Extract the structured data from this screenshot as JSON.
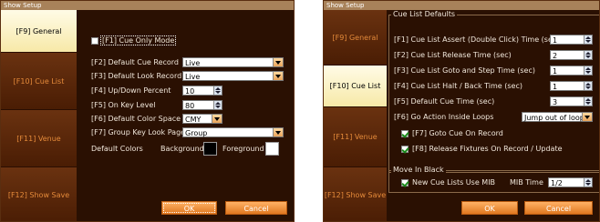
{
  "left_window": {
    "title": "Show Setup",
    "tabs": [
      "[F9] General",
      "[F10] Cue List",
      "[F11] Venue",
      "[F12] Show Save"
    ],
    "cue_only_mode_label": "[F1] Cue Only Mode",
    "fields": {
      "default_cue_record": {
        "label": "[F2] Default Cue Record",
        "value": "Live"
      },
      "default_look_record": {
        "label": "[F3] Default Look Record",
        "value": "Live"
      },
      "updown_percent": {
        "label": "[F4] Up/Down Percent",
        "value": "10"
      },
      "on_key_level": {
        "label": "[F5] On Key Level",
        "value": "80"
      },
      "default_color_space": {
        "label": "[F6] Default Color Space",
        "value": "CMY"
      },
      "group_key_look_page": {
        "label": "[F7] Group Key Look Page",
        "value": "Group"
      }
    },
    "default_colors_label": "Default Colors",
    "background_label": "Background",
    "foreground_label": "Foreground",
    "colors": {
      "background": "#000000",
      "foreground": "#ffffff"
    },
    "ok_label": "OK",
    "cancel_label": "Cancel"
  },
  "right_window": {
    "title": "Show Setup",
    "tabs": [
      "[F9] General",
      "[F10] Cue List",
      "[F11] Venue",
      "[F12] Show Save"
    ],
    "cue_list_defaults_label": "Cue List Defaults",
    "rows": [
      {
        "label": "[F1] Cue List Assert (Double Click) Time (sec)",
        "value": "1"
      },
      {
        "label": "[F2] Cue List Release Time (sec)",
        "value": "2"
      },
      {
        "label": "[F3] Cue List Goto and Step Time (sec)",
        "value": "1"
      },
      {
        "label": "[F4] Cue List Halt / Back Time (sec)",
        "value": "1"
      },
      {
        "label": "[F5] Default Cue Time (sec)",
        "value": "3"
      }
    ],
    "go_action_label": "[F6] Go Action Inside Loops",
    "go_action_value": "Jump out of loop",
    "goto_cue_label": "[F7] Goto Cue On Record",
    "release_fixtures_label": "[F8] Release Fixtures On Record / Update",
    "move_in_black_label": "Move In Black",
    "new_cue_lists_label": "New Cue Lists Use MIB",
    "mib_time_label": "MIB Time",
    "mib_time_value": "1/2",
    "ok_label": "OK",
    "cancel_label": "Cancel"
  }
}
